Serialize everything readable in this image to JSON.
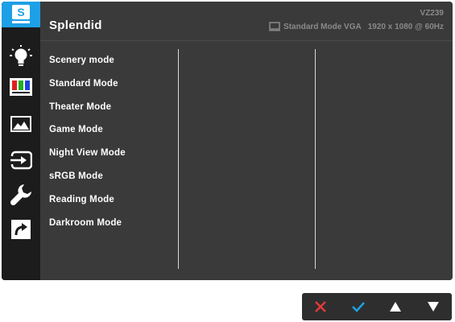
{
  "header": {
    "title": "Splendid",
    "model": "VZ239",
    "mode": "Standard Mode VGA",
    "resolution": "1920 x 1080 @ 60Hz"
  },
  "sidebar": {
    "items": [
      {
        "icon": "splendid-icon",
        "active": true,
        "badge": "S"
      },
      {
        "icon": "blue-light-filter-icon",
        "active": false
      },
      {
        "icon": "color-icon",
        "active": false
      },
      {
        "icon": "image-icon",
        "active": false
      },
      {
        "icon": "input-select-icon",
        "active": false
      },
      {
        "icon": "system-setup-icon",
        "active": false
      },
      {
        "icon": "shortcut-icon",
        "active": false
      }
    ]
  },
  "menu": {
    "items": [
      "Scenery mode",
      "Standard Mode",
      "Theater Mode",
      "Game Mode",
      "Night View Mode",
      "sRGB Mode",
      "Reading Mode",
      "Darkroom Mode"
    ]
  },
  "colors": {
    "accent": "#1ea0e6",
    "panel": "#3a3a3a",
    "sidebar": "#1c1c1c",
    "close": "#e23a3a",
    "ok": "#1ea0e6"
  },
  "buttons": [
    "close-icon",
    "check-icon",
    "up-arrow-icon",
    "down-arrow-icon"
  ]
}
